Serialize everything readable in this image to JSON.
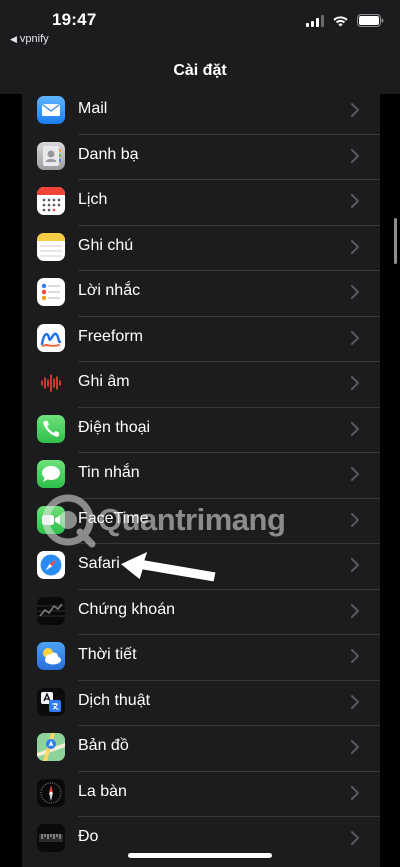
{
  "status_bar": {
    "time": "19:47",
    "back_app": "vpnify"
  },
  "nav": {
    "title": "Cài đặt"
  },
  "settings": [
    {
      "label": "Mail",
      "icon": "mail-icon",
      "color": "#2f8bf5"
    },
    {
      "label": "Danh bạ",
      "icon": "contacts-icon",
      "color": "#a9a9ab"
    },
    {
      "label": "Lịch",
      "icon": "calendar-icon",
      "color": "#ffffff"
    },
    {
      "label": "Ghi chú",
      "icon": "notes-icon",
      "color": "#ffffff"
    },
    {
      "label": "Lời nhắc",
      "icon": "reminders-icon",
      "color": "#ffffff"
    },
    {
      "label": "Freeform",
      "icon": "freeform-icon",
      "color": "#ffffff"
    },
    {
      "label": "Ghi âm",
      "icon": "voice-memos-icon",
      "color": "#1c1c1e"
    },
    {
      "label": "Điện thoại",
      "icon": "phone-icon",
      "color": "#34c759"
    },
    {
      "label": "Tin nhắn",
      "icon": "messages-icon",
      "color": "#34c759"
    },
    {
      "label": "FaceTime",
      "icon": "facetime-icon",
      "color": "#34c759"
    },
    {
      "label": "Safari",
      "icon": "safari-icon",
      "color": "#ffffff"
    },
    {
      "label": "Chứng khoán",
      "icon": "stocks-icon",
      "color": "#000000"
    },
    {
      "label": "Thời tiết",
      "icon": "weather-icon",
      "color": "#3b8fe8"
    },
    {
      "label": "Dịch thuật",
      "icon": "translate-icon",
      "color": "#0b0b0d"
    },
    {
      "label": "Bản đồ",
      "icon": "maps-icon",
      "color": "#7fcf8a"
    },
    {
      "label": "La bàn",
      "icon": "compass-icon",
      "color": "#000000"
    },
    {
      "label": "Đo",
      "icon": "measure-icon",
      "color": "#000000"
    }
  ],
  "watermark": {
    "text": "Quantrimang"
  }
}
